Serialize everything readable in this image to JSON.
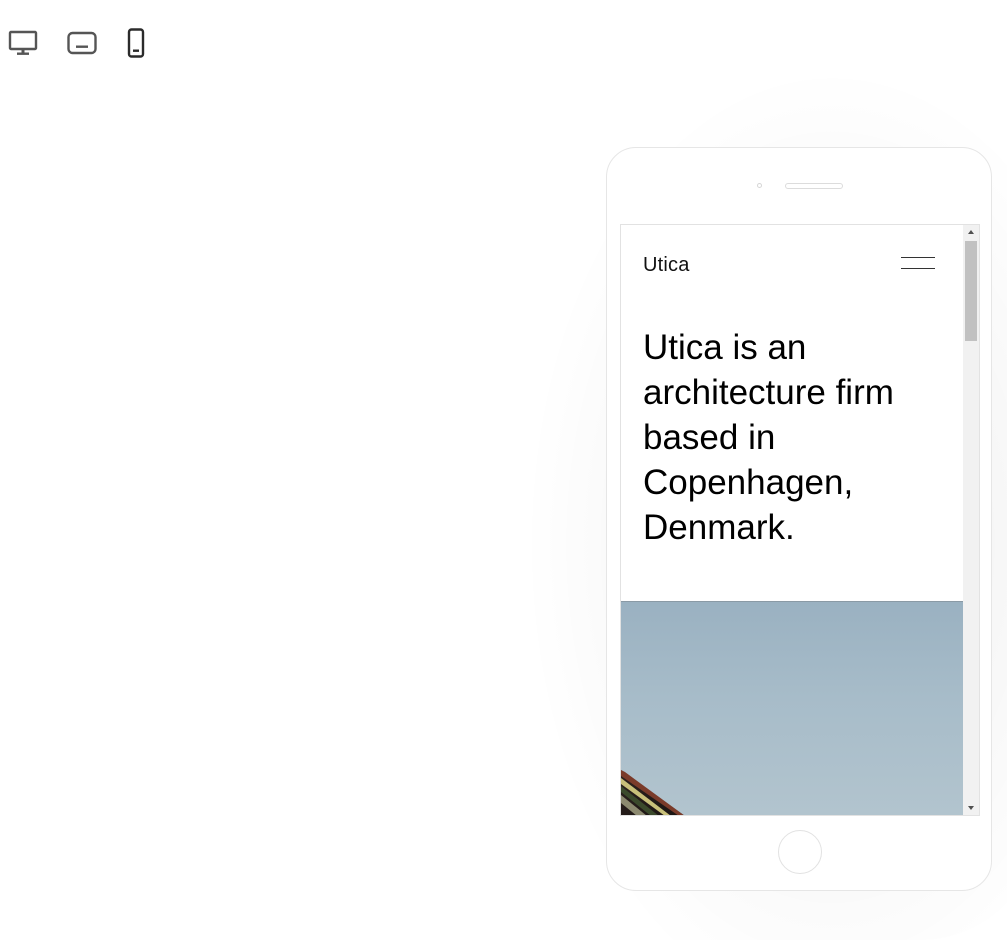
{
  "toolbar": {
    "devices": [
      {
        "name": "Desktop",
        "icon": "desktop-icon",
        "active": false
      },
      {
        "name": "Tablet",
        "icon": "tablet-icon",
        "active": false
      },
      {
        "name": "Mobile",
        "icon": "mobile-icon",
        "active": true
      }
    ],
    "icon_color": "#555555",
    "active_icon_color": "#2b2b2b"
  },
  "preview": {
    "site": {
      "logo": "Utica",
      "menu_icon": "hamburger-icon",
      "hero_text": "Utica is an architecture firm based in Copenhagen, Denmark.",
      "hero_image": "sky-building-photo"
    },
    "scrollbar": {
      "up_icon": "arrow-up-icon",
      "down_icon": "arrow-down-icon"
    }
  }
}
